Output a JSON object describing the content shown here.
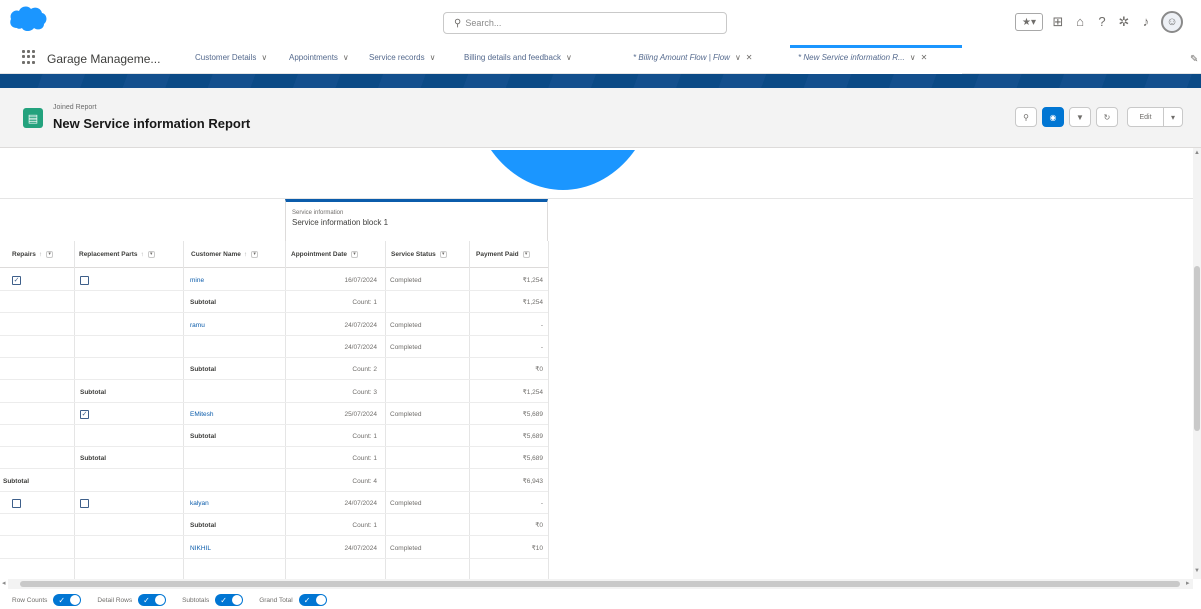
{
  "header": {
    "search_placeholder": "Search..."
  },
  "nav": {
    "app_name": "Garage Manageme...",
    "tabs": [
      {
        "label": "Customer Details"
      },
      {
        "label": "Appointments"
      },
      {
        "label": "Service records"
      },
      {
        "label": "Billing details and feedback"
      },
      {
        "label": "* Biling Amount Flow | Flow"
      },
      {
        "label": "* New Service information R..."
      }
    ]
  },
  "report": {
    "type_label": "Joined Report",
    "title": "New Service information Report",
    "edit_label": "Edit"
  },
  "block": {
    "caption": "Service information",
    "name": "Service information block 1"
  },
  "columns": {
    "repairs": "Repairs",
    "replacement_parts": "Replacement Parts",
    "customer_name": "Customer Name",
    "appointment_date": "Appointment Date",
    "service_status": "Service Status",
    "payment_paid": "Payment Paid"
  },
  "rows": [
    {
      "repairs_cb": "checked",
      "parts_cb": "unchecked",
      "name": "mine",
      "date": "16/07/2024",
      "status": "Completed",
      "paid": "₹1,254"
    },
    {
      "name_sub": "Subtotal",
      "count": "Count: 1",
      "paid": "₹1,254"
    },
    {
      "name": "ramu",
      "date": "24/07/2024",
      "status": "Completed",
      "paid": "-"
    },
    {
      "date": "24/07/2024",
      "status": "Completed",
      "paid": "-"
    },
    {
      "name_sub": "Subtotal",
      "count": "Count: 2",
      "paid": "₹0"
    },
    {
      "parts_sub": "Subtotal",
      "count": "Count: 3",
      "paid": "₹1,254"
    },
    {
      "parts_cb": "checked",
      "name": "EMitesh",
      "date": "25/07/2024",
      "status": "Completed",
      "paid": "₹5,689"
    },
    {
      "name_sub": "Subtotal",
      "count": "Count: 1",
      "paid": "₹5,689"
    },
    {
      "parts_sub": "Subtotal",
      "count": "Count: 1",
      "paid": "₹5,689"
    },
    {
      "repairs_sub": "Subtotal",
      "count": "Count: 4",
      "paid": "₹6,943"
    },
    {
      "repairs_cb": "unchecked",
      "parts_cb": "unchecked",
      "name": "kalyan",
      "date": "24/07/2024",
      "status": "Completed",
      "paid": "-"
    },
    {
      "name_sub": "Subtotal",
      "count": "Count: 1",
      "paid": "₹0"
    },
    {
      "name": "NIKHIL",
      "date": "24/07/2024",
      "status": "Completed",
      "paid": "₹10"
    }
  ],
  "footer": {
    "row_counts": "Row Counts",
    "detail_rows": "Detail Rows",
    "subtotals": "Subtotals",
    "grand_total": "Grand Total"
  },
  "colors": {
    "brand_blue": "#1b96ff",
    "link_blue": "#0b5cab",
    "report_icon_green": "#23a27d",
    "toggle_blue": "#0176d3"
  }
}
